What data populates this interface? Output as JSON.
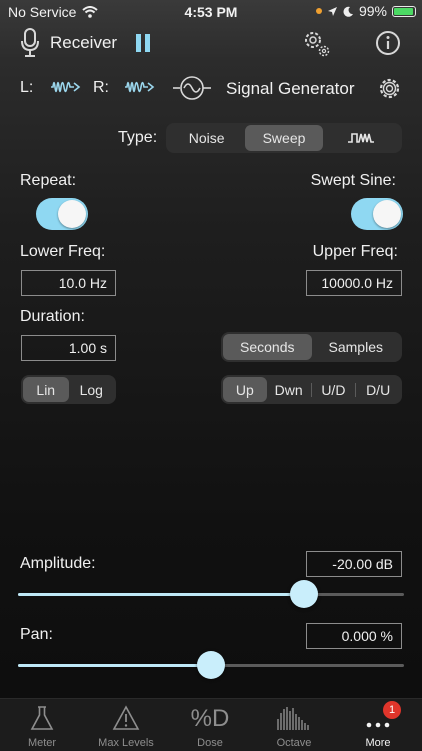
{
  "status_bar": {
    "carrier": "No Service",
    "time": "4:53 PM",
    "battery": "99%"
  },
  "header": {
    "mode_label": "Receiver",
    "icons": [
      "microphone-icon",
      "pause-icon",
      "gear-icon",
      "info-icon"
    ]
  },
  "channels": {
    "left_label": "L:",
    "right_label": "R:",
    "generator_label": "Signal Generator"
  },
  "type_selector": {
    "label": "Type:",
    "options": [
      "Noise",
      "Sweep"
    ],
    "selected": "Sweep"
  },
  "repeat": {
    "label": "Repeat:",
    "on": true
  },
  "swept_sine": {
    "label": "Swept Sine:",
    "on": true
  },
  "lower_freq": {
    "label": "Lower Freq:",
    "value": "10.0 Hz"
  },
  "upper_freq": {
    "label": "Upper Freq:",
    "value": "10000.0 Hz"
  },
  "duration": {
    "label": "Duration:",
    "value": "1.00 s"
  },
  "units": {
    "options": [
      "Seconds",
      "Samples"
    ],
    "selected": "Seconds"
  },
  "scale": {
    "options": [
      "Lin",
      "Log"
    ],
    "selected": "Lin"
  },
  "direction": {
    "options": [
      "Up",
      "Dwn",
      "U/D",
      "D/U"
    ],
    "selected": "Up"
  },
  "amplitude": {
    "label": "Amplitude:",
    "value": "-20.00 dB",
    "slider_fraction": 0.74
  },
  "pan": {
    "label": "Pan:",
    "value": "0.000 %",
    "slider_fraction": 0.5
  },
  "tab_bar": {
    "tabs": [
      {
        "label": "Meter",
        "icon": "flask-icon"
      },
      {
        "label": "Max Levels",
        "icon": "warning-icon"
      },
      {
        "label": "Dose",
        "icon": "percent-d-icon",
        "glyph": "%D"
      },
      {
        "label": "Octave",
        "icon": "bars-icon"
      },
      {
        "label": "More",
        "icon": "more-icon",
        "badge": "1",
        "active": true
      }
    ]
  },
  "colors": {
    "accent": "#8fd8f2",
    "badge": "#e0352b",
    "battery": "#4cd964"
  }
}
